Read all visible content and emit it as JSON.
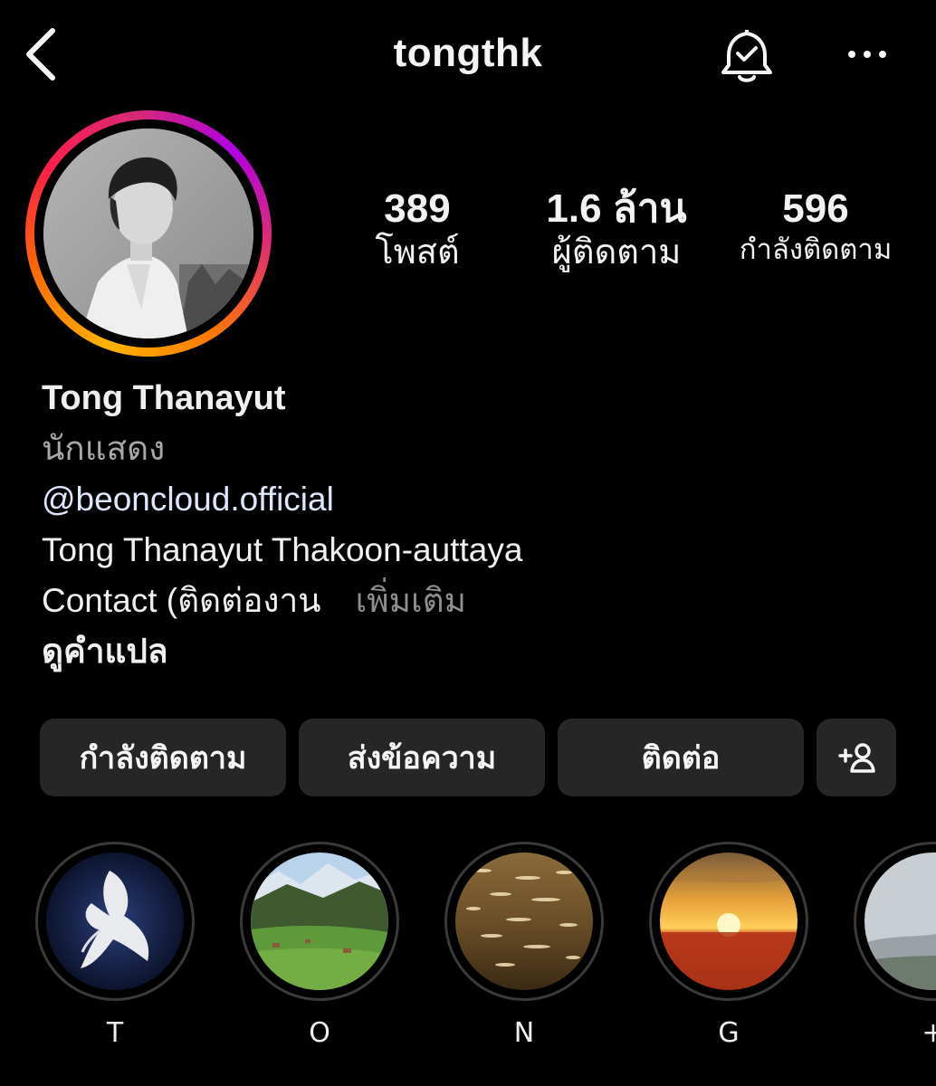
{
  "header": {
    "username": "tongthk",
    "back_icon": "chevron-left-icon",
    "bell_icon": "bell-check-icon",
    "more_icon": "more-horizontal-icon"
  },
  "stats": {
    "posts": {
      "value": "389",
      "label": "โพสต์"
    },
    "followers": {
      "value": "1.6 ล้าน",
      "label": "ผู้ติดตาม"
    },
    "following": {
      "value": "596",
      "label": "กำลังติดตาม"
    }
  },
  "bio": {
    "name": "Tong Thanayut",
    "category": "นักแสดง",
    "handle": "@beoncloud.official",
    "line1": "Tong Thanayut Thakoon-auttaya",
    "line2": "Contact (ติดต่องาน",
    "more": "เพิ่มเติม",
    "translate": "ดูคำแปล"
  },
  "buttons": {
    "following": "กำลังติดตาม",
    "message": "ส่งข้อความ",
    "contact": "ติดต่อ",
    "suggest_icon": "add-person-icon"
  },
  "highlights": [
    {
      "label": "T"
    },
    {
      "label": "O"
    },
    {
      "label": "N"
    },
    {
      "label": "G"
    },
    {
      "label": "+"
    }
  ],
  "colors": {
    "background": "#000000",
    "button_bg": "#262626",
    "link": "#dfe7ff",
    "muted": "#8e8e8e",
    "story_ring": [
      "#ffb300",
      "#ff1f4b",
      "#b000e5"
    ]
  }
}
